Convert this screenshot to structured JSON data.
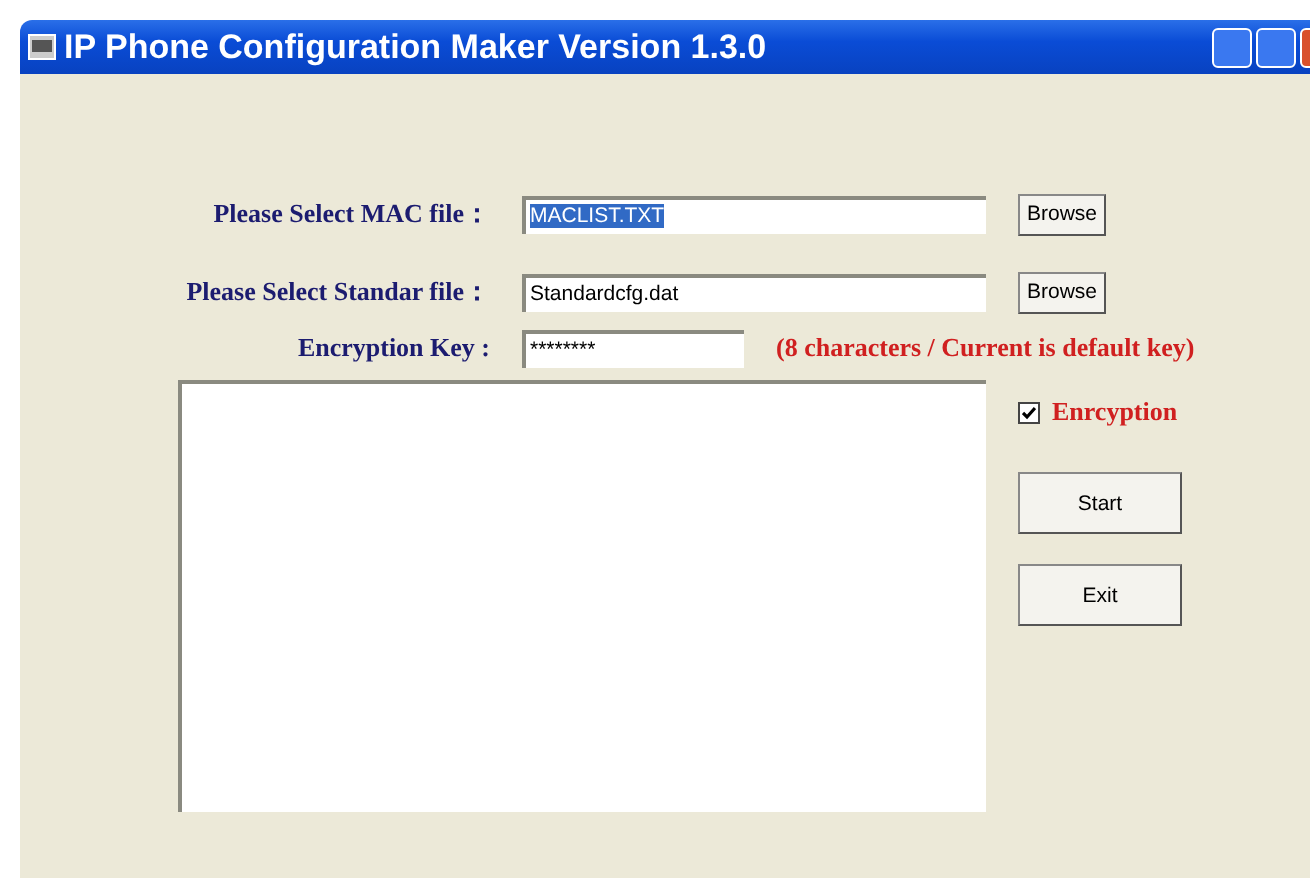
{
  "window": {
    "title": "IP Phone Configuration Maker Version 1.3.0"
  },
  "file_rows": [
    {
      "label": "Please Select MAC file：",
      "value": "MACLIST.TXT",
      "text_selected": true,
      "button": "Browse"
    },
    {
      "label": "Please Select Standar file：",
      "value": "Standardcfg.dat",
      "text_selected": false,
      "button": "Browse"
    }
  ],
  "key_row": {
    "label": "Encryption Key :",
    "value": "********",
    "note": "(8 characters /  Current is default key)"
  },
  "encryption": {
    "label": "Enrcyption",
    "checked": true
  },
  "buttons": [
    "Start",
    "Exit"
  ]
}
